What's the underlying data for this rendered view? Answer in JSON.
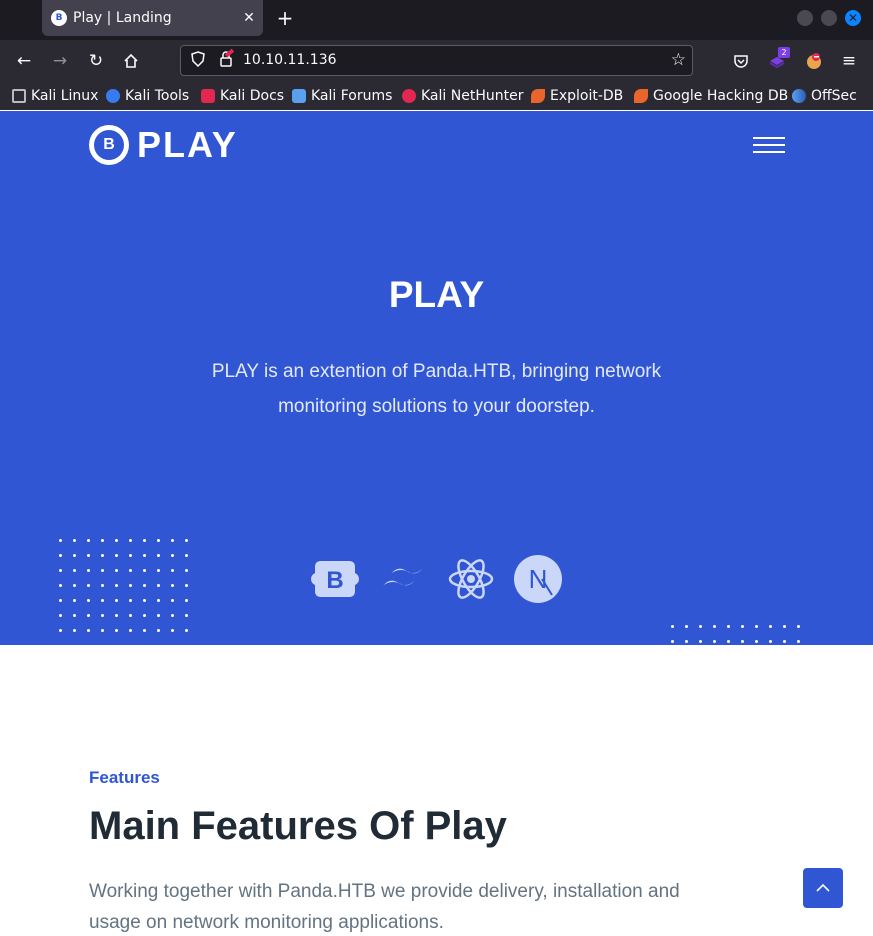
{
  "browser": {
    "tab_title": "Play | Landing",
    "tab_close": "✕",
    "new_tab": "+",
    "url": "10.10.11.136",
    "extension_badge": "2",
    "bookmarks": [
      {
        "label": "Kali Linux",
        "icon": "kali-dragon-icon"
      },
      {
        "label": "Kali Tools",
        "icon": "kali-tools-icon"
      },
      {
        "label": "Kali Docs",
        "icon": "kali-docs-icon"
      },
      {
        "label": "Kali Forums",
        "icon": "kali-forums-icon"
      },
      {
        "label": "Kali NetHunter",
        "icon": "kali-nethunter-icon"
      },
      {
        "label": "Exploit-DB",
        "icon": "exploit-db-icon"
      },
      {
        "label": "Google Hacking DB",
        "icon": "ghdb-icon"
      },
      {
        "label": "OffSec",
        "icon": "offsec-icon"
      }
    ]
  },
  "hero": {
    "logo_mark": "B",
    "logo_text": "PLAY",
    "title": "PLAY",
    "description": "PLAY is an extention of Panda.HTB, bringing network monitoring solutions to your doorstep.",
    "tech_icons": [
      "bootstrap-icon",
      "tailwind-icon",
      "react-icon",
      "nextjs-icon"
    ],
    "bootstrap_glyph": "B",
    "next_glyph": "N"
  },
  "features": {
    "label": "Features",
    "title": "Main Features Of Play",
    "description": "Working together with Panda.HTB we provide delivery, installation and usage on network monitoring applications."
  },
  "colors": {
    "accent": "#3056d3",
    "heading": "#212b36",
    "body_text": "#637381"
  }
}
